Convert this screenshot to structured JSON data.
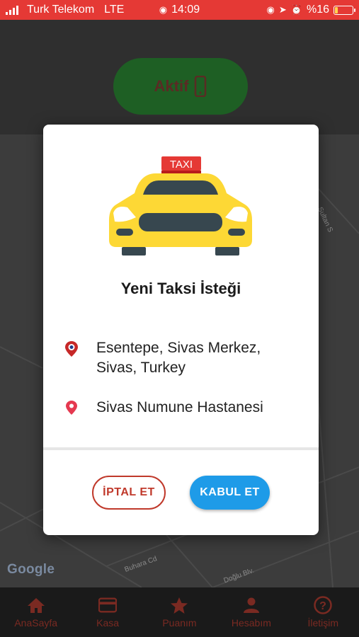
{
  "status_bar": {
    "carrier": "Turk Telekom",
    "network": "LTE",
    "time": "14:09",
    "battery": "%16",
    "battery_level": 0.16
  },
  "background": {
    "active_label": "Aktif",
    "google_logo": "Google",
    "map_labels": [
      "Buhara Cd",
      "Sultan S",
      "Doğlu Blv."
    ]
  },
  "modal": {
    "taxi_sign": "TAXI",
    "title": "Yeni Taksi İsteği",
    "pickup_line1": "Esentepe, Sivas Merkez,",
    "pickup_line2": "Sivas, Turkey",
    "destination": "Sivas Numune Hastanesi",
    "cancel_label": "İPTAL ET",
    "accept_label": "KABUL ET"
  },
  "bottom_nav": {
    "items": [
      {
        "label": "AnaSayfa",
        "icon": "home-icon"
      },
      {
        "label": "Kasa",
        "icon": "card-icon"
      },
      {
        "label": "Puanım",
        "icon": "star-icon"
      },
      {
        "label": "Hesabım",
        "icon": "person-icon"
      },
      {
        "label": "İletişim",
        "icon": "help-icon"
      }
    ]
  },
  "colors": {
    "status_bar": "#e53935",
    "accept": "#1e9be8",
    "cancel": "#c0392b",
    "taxi_yellow": "#fdd835"
  }
}
